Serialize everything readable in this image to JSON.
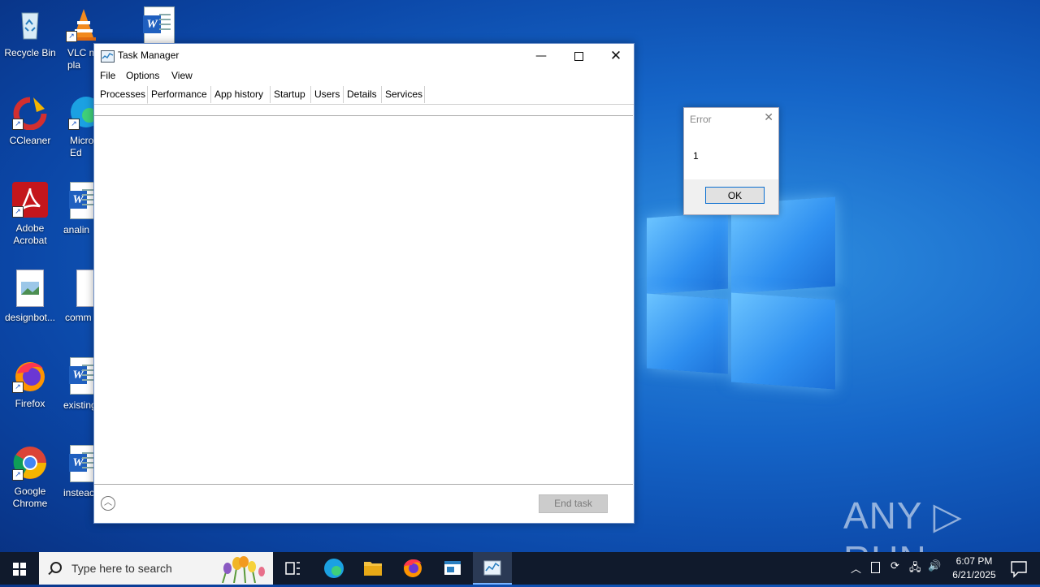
{
  "desktop": {
    "icons": [
      {
        "label": "Recycle Bin"
      },
      {
        "label": "VLC m\npla"
      },
      {
        "label": ""
      },
      {
        "label": "CCleaner"
      },
      {
        "label": "Micro\nEd"
      },
      {
        "label": "Adobe\nAcrobat"
      },
      {
        "label": "analin"
      },
      {
        "label": "designbot..."
      },
      {
        "label": "comm"
      },
      {
        "label": "Firefox"
      },
      {
        "label": "existing"
      },
      {
        "label": "Google\nChrome"
      },
      {
        "label": "insteac"
      }
    ]
  },
  "task_manager": {
    "title": "Task Manager",
    "menu": [
      "File",
      "Options",
      "View"
    ],
    "tabs": [
      "Processes",
      "Performance",
      "App history",
      "Startup",
      "Users",
      "Details",
      "Services"
    ],
    "active_tab": "Processes",
    "end_task_label": "End task"
  },
  "error_dialog": {
    "title": "Error",
    "message": "1",
    "ok_label": "OK"
  },
  "watermark": "ANY ▷ RUN",
  "taskbar": {
    "search_placeholder": "Type here to search",
    "time": "6:07 PM",
    "date": "6/21/2025"
  },
  "colors": {
    "accent": "#0b6fd0",
    "taskbar": "#101a2c"
  }
}
